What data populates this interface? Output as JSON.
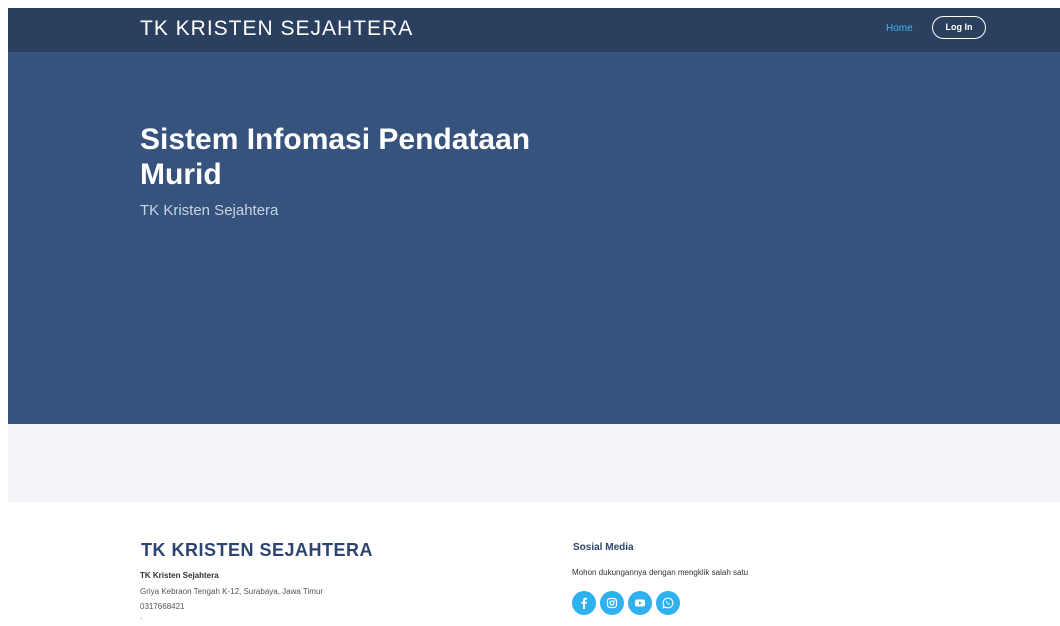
{
  "navbar": {
    "brand": "TK KRISTEN SEJAHTERA",
    "home_label": "Home",
    "login_label": "Log In"
  },
  "hero": {
    "title": "Sistem Infomasi Pendataan Murid",
    "subtitle": "TK Kristen Sejahtera"
  },
  "footer": {
    "brand": "TK KRISTEN SEJAHTERA",
    "name": "TK Kristen Sejahtera",
    "address": "Griya Kebraon Tengah K-12, Surabaya, Jawa Timur",
    "phone": "0317668421",
    "link_text": "-",
    "social": {
      "heading": "Sosial Media",
      "text": "Mohon dukungannya dengan mengklik salah satu",
      "icons": [
        "facebook-icon",
        "instagram-icon",
        "youtube-icon",
        "whatsapp-icon"
      ]
    }
  },
  "colors": {
    "navbar_bg": "#2b3f5f",
    "hero_bg": "#36537e",
    "band_bg": "#f3f5f9",
    "accent": "#2fb1ef",
    "footer_brand": "#2d4470"
  }
}
